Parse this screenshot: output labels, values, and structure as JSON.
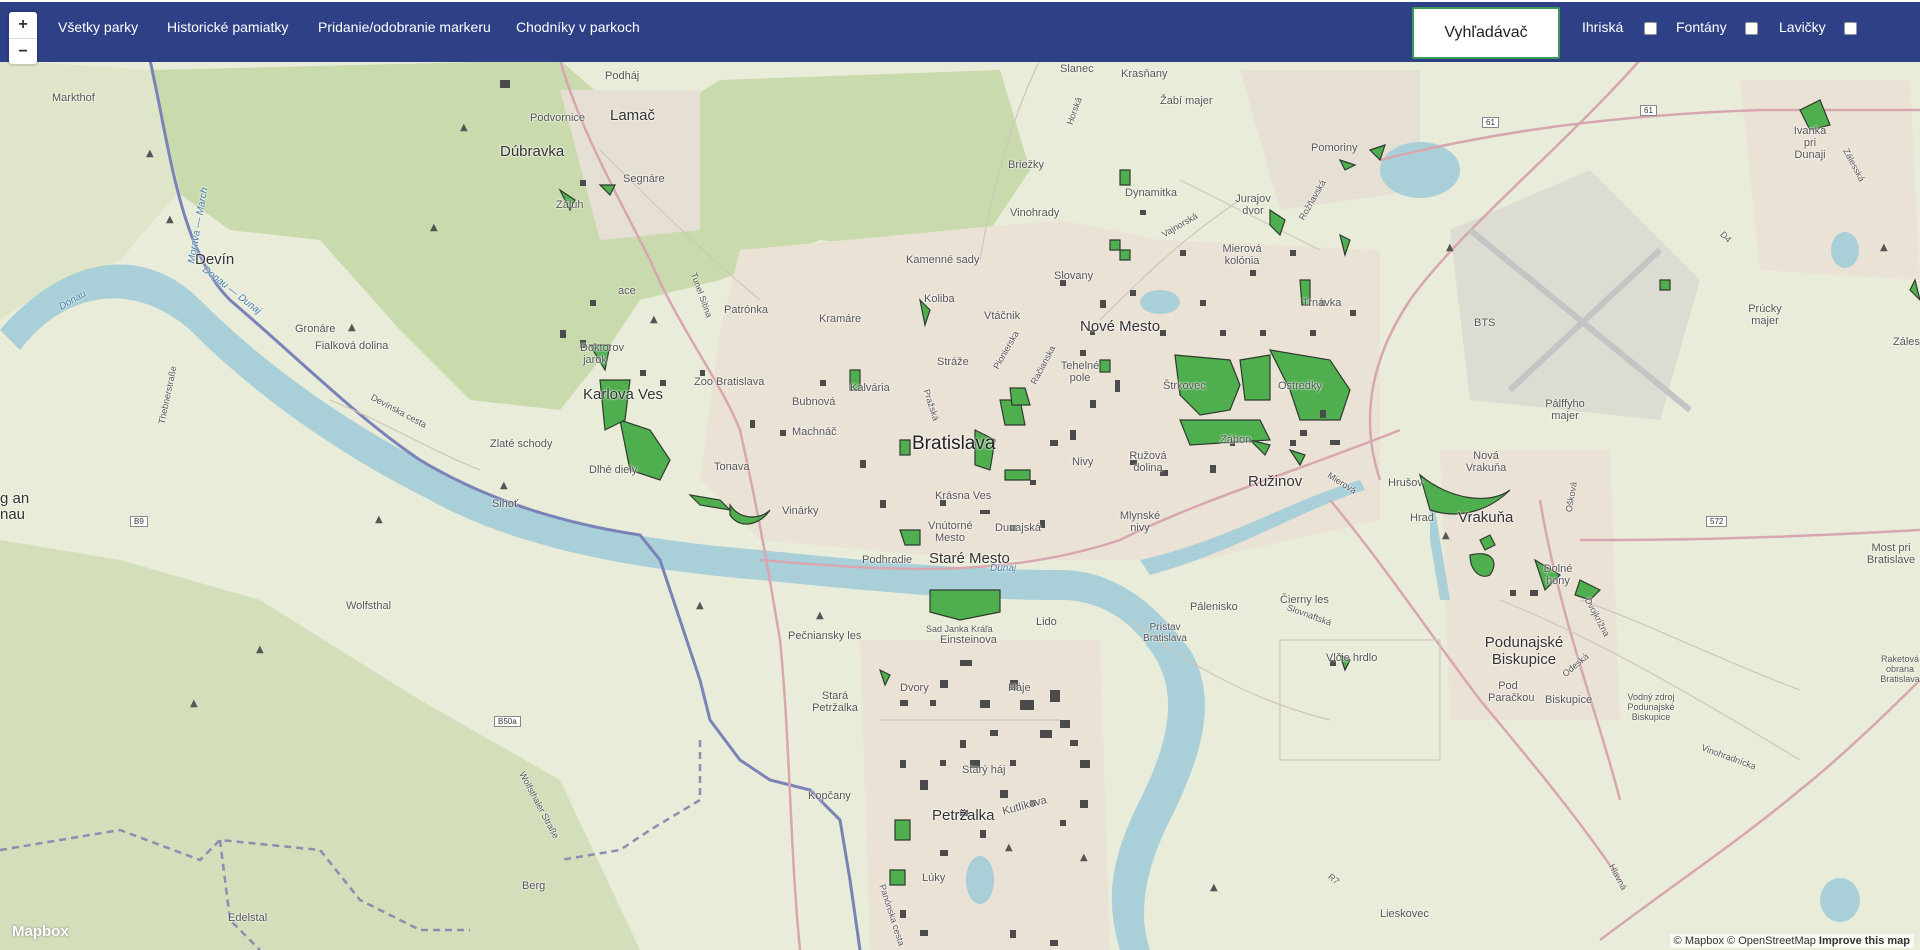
{
  "nav": {
    "links": [
      "Všetky parky",
      "Historické pamiatky",
      "Pridanie/odobranie markeru",
      "Chodníky v parkoch"
    ],
    "search_label": "Vyhľadávač",
    "toggles": [
      "Ihriská",
      "Fontány",
      "Lavičky"
    ]
  },
  "zoom": {
    "in": "+",
    "out": "−"
  },
  "map": {
    "labels": {
      "markthof": "Markthof",
      "dubravka": "Dúbravka",
      "lamac": "Lamač",
      "podhaj": "Podháj",
      "podvornice": "Podvornice",
      "segnare": "Segnáre",
      "zaluh": "Záluh",
      "devin": "Devín",
      "gronare": "Gronáre",
      "fialkova": "Fialková dolina",
      "karlova": "Karlova Ves",
      "dlhe": "Dlhé diely",
      "zlate": "Zlaté schody",
      "sihot": "Sihoť",
      "tonava": "Tonava",
      "zoo": "Zoo Bratislava",
      "patronka": "Patrónka",
      "kramare": "Kramáre",
      "kolíba": "Koliba",
      "kamenne": "Kamenné sady",
      "bratislava": "Bratislava",
      "stare": "Staré Mesto",
      "nove": "Nové Mesto",
      "ruzinov": "Ružinov",
      "vrakuna": "Vrakuňa",
      "bts": "BTS",
      "podunajske": "Podunajské Biskupice",
      "petrzalka": "Petržalka",
      "stara_petrzalka": "Stará Petržalka",
      "dvory": "Dvory",
      "hale": "Háje",
      "lido": "Lido",
      "einsteinova": "Einsteinova",
      "sad": "Sad Janka Kráľa",
      "pecniansky": "Pečniansky les",
      "kopcany": "Kopčany",
      "wolfsthal": "Wolfsthal",
      "berg": "Berg",
      "edelstal": "Edelstal",
      "dynamitka": "Dynamitka",
      "briezky": "Briežky",
      "vinohrady": "Vinohrady",
      "krasnany": "Krasňany",
      "slanec": "Slanec",
      "pomoriny": "Pomoriny",
      "trnavka": "Trnávka",
      "jurajov": "Jurajov dvor",
      "mierova": "Mierová kolónia",
      "palffyho": "Pálffyho majer",
      "prucky": "Prúcky majer",
      "ivanka": "Ivanka pri Dunaji",
      "most": "Most pri Bratislave",
      "zabi": "Žabí majer",
      "cierny": "Čierny les",
      "palenisko": "Pálenisko",
      "pristav": "Prístav Bratislava",
      "vodny_zdroj": "Vodný zdroj Podunajské Biskupice",
      "stary_haj": "Starý háj",
      "luky": "Lúky",
      "kutlikova": "Kutlíkova",
      "nova_vrakuna": "Nová Vrakuňa",
      "dolne": "Dolné hony",
      "rakyt": "Raketová obrana Bratislava",
      "lieskovec": "Lieskovec",
      "hrusov": "Hrušov",
      "danube1": "Donau",
      "danube2": "Dunaj",
      "danube3": "Donau — Dunaj",
      "morava": "Morava — March",
      "vinarky": "Vinárky",
      "machnac": "Machnáč",
      "bubnova": "Bubnová",
      "kalvaria": "Kalvária",
      "straze": "Stráže",
      "vracnik": "Vtáčnik",
      "slovany": "Slovany",
      "nivy": "Nivy",
      "ruzova": "Ružová dolina",
      "mlynske": "Mlynské nivy",
      "krasna": "Krásna Ves",
      "vnutorne": "Vnútorné Mesto",
      "dunajska": "Dunajská",
      "podhradie": "Podhradie",
      "strkovec": "Štrkovec",
      "ostredky": "Ostredky",
      "zahon": "Záhon",
      "vlcie": "Vlčie hrdlo",
      "pod_parackou": "Pod Paračkou",
      "biskupice": "Biskupice",
      "zales": "Záles",
      "b9": "B9",
      "b50a": "B50a",
      "r61a": "61",
      "r61b": "61",
      "r572": "572",
      "d4": "D4",
      "r7": "R7",
      "wolfsthaler": "Wolfsthaler Straße",
      "thebener": "Thebnerstraße",
      "devinska": "Devínska cesta",
      "vajnorska": "Vajnorská",
      "rozhanska": "Rožňavská",
      "slovnaftska": "Slovnaftská",
      "odeska": "Odeská",
      "dvojkrizna": "Dvojkrížna",
      "vinohradnicka": "Vinohradnícka",
      "hlavna": "Hlavná",
      "oskova": "Ošková",
      "zalesska": "Zálesská",
      "horska": "Horská",
      "racianska": "Račianska",
      "prazska": "Pražská",
      "pionierska": "Pionierska",
      "mierova_st": "Mierová",
      "tunel": "Tunel Sitina",
      "panonska": "Panónska cesta",
      "doktorov": "Doktorov jarok",
      "ace": "ace",
      "hrad": "Hrad",
      "na_slav": "Tehelné pole",
      "gan": "g an",
      "nau": "nau"
    }
  },
  "attribution": {
    "mapbox": "© Mapbox",
    "osm": "© OpenStreetMap",
    "improve": "Improve this map"
  },
  "logo": "Mapbox",
  "colors": {
    "navbar": "#2f4186",
    "park_fill": "#4caf50",
    "water": "#b8d8e0",
    "forest": "#c9dcb0",
    "urban": "#ece6da"
  }
}
